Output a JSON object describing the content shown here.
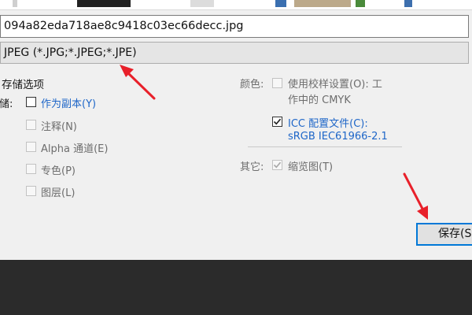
{
  "file": {
    "name": "094a82eda718ae8c9418c03ec66decc.jpg",
    "format": "JPEG (*.JPG;*.JPEG;*.JPE)"
  },
  "save_options": {
    "title": "存储选项",
    "store_label": "存储:",
    "as_copy": {
      "label": "作为副本(Y)",
      "checked": false,
      "enabled": true
    },
    "notes": {
      "label": "注释(N)",
      "checked": false,
      "enabled": false
    },
    "alpha": {
      "label": "Alpha 通道(E)",
      "checked": false,
      "enabled": false
    },
    "spot": {
      "label": "专色(P)",
      "checked": false,
      "enabled": false
    },
    "layers": {
      "label": "图层(L)",
      "checked": false,
      "enabled": false
    }
  },
  "color": {
    "label": "颜色:",
    "proof_line1": "使用校样设置(O):  工",
    "proof_line2": "作中的 CMYK",
    "icc_line1": "ICC 配置文件(C):",
    "icc_line2": "sRGB IEC61966-2.1",
    "icc_checked": true
  },
  "other": {
    "label": "其它:",
    "thumbnail": {
      "label": "缩览图(T)",
      "checked": true,
      "enabled": false
    }
  },
  "buttons": {
    "save": "保存(S)"
  },
  "colors": {
    "accent": "#0078d7",
    "link": "#1e66c8",
    "annotation_arrow": "#e8202a"
  }
}
